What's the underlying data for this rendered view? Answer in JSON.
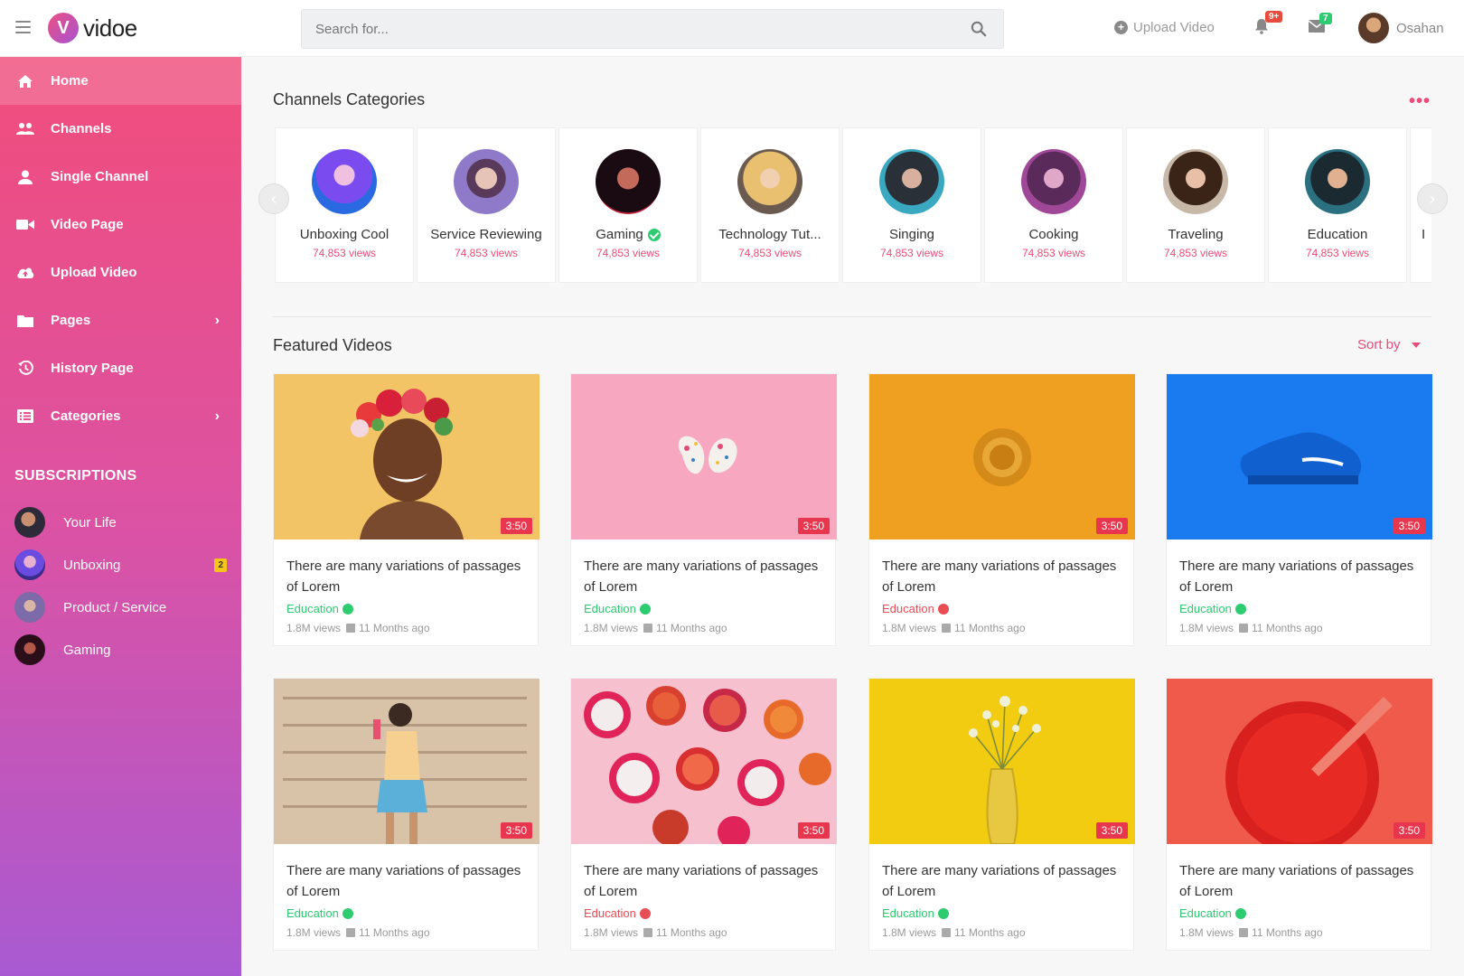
{
  "app": {
    "logo_letter": "V",
    "logo_text": "vidoe"
  },
  "header": {
    "search_placeholder": "Search for...",
    "upload_label": "Upload Video",
    "notif_count": "9+",
    "mail_count": "7",
    "user_name": "Osahan"
  },
  "sidebar": {
    "items": [
      {
        "label": "Home",
        "icon": "home-icon"
      },
      {
        "label": "Channels",
        "icon": "users-icon"
      },
      {
        "label": "Single Channel",
        "icon": "user-icon"
      },
      {
        "label": "Video Page",
        "icon": "video-camera-icon"
      },
      {
        "label": "Upload Video",
        "icon": "cloud-upload-icon"
      },
      {
        "label": "Pages",
        "icon": "folder-icon",
        "chevron": "›"
      },
      {
        "label": "History Page",
        "icon": "history-icon"
      },
      {
        "label": "Categories",
        "icon": "list-icon",
        "chevron": "›"
      }
    ],
    "subscriptions_title": "SUBSCRIPTIONS",
    "subscriptions": [
      {
        "label": "Your Life"
      },
      {
        "label": "Unboxing",
        "badge": "2"
      },
      {
        "label": "Product / Service"
      },
      {
        "label": "Gaming"
      }
    ]
  },
  "channels": {
    "title": "Channels Categories",
    "more": "•••",
    "items": [
      {
        "name": "Unboxing Cool",
        "views": "74,853 views"
      },
      {
        "name": "Service Reviewing",
        "views": "74,853 views"
      },
      {
        "name": "Gaming",
        "views": "74,853 views",
        "verified": true
      },
      {
        "name": "Technology Tut...",
        "views": "74,853 views"
      },
      {
        "name": "Singing",
        "views": "74,853 views"
      },
      {
        "name": "Cooking",
        "views": "74,853 views"
      },
      {
        "name": "Traveling",
        "views": "74,853 views"
      },
      {
        "name": "Education",
        "views": "74,853 views"
      },
      {
        "name": "I",
        "views": ""
      }
    ],
    "prev": "‹",
    "next": "›"
  },
  "featured": {
    "title": "Featured Videos",
    "sort_label": "Sort by",
    "videos": [
      {
        "title": "There are many variations of passages of Lorem",
        "category": "Education",
        "status": "green",
        "views": "1.8M views",
        "age": "11 Months ago",
        "duration": "3:50"
      },
      {
        "title": "There are many variations of passages of Lorem",
        "category": "Education",
        "status": "green",
        "views": "1.8M views",
        "age": "11 Months ago",
        "duration": "3:50"
      },
      {
        "title": "There are many variations of passages of Lorem",
        "category": "Education",
        "status": "red",
        "views": "1.8M views",
        "age": "11 Months ago",
        "duration": "3:50"
      },
      {
        "title": "There are many variations of passages of Lorem",
        "category": "Education",
        "status": "green",
        "views": "1.8M views",
        "age": "11 Months ago",
        "duration": "3:50"
      },
      {
        "title": "There are many variations of passages of Lorem",
        "category": "Education",
        "status": "green",
        "views": "1.8M views",
        "age": "11 Months ago",
        "duration": "3:50"
      },
      {
        "title": "There are many variations of passages of Lorem",
        "category": "Education",
        "status": "red",
        "views": "1.8M views",
        "age": "11 Months ago",
        "duration": "3:50"
      },
      {
        "title": "There are many variations of passages of Lorem",
        "category": "Education",
        "status": "green",
        "views": "1.8M views",
        "age": "11 Months ago",
        "duration": "3:50"
      },
      {
        "title": "There are many variations of passages of Lorem",
        "category": "Education",
        "status": "green",
        "views": "1.8M views",
        "age": "11 Months ago",
        "duration": "3:50"
      }
    ]
  },
  "colors": {
    "accent": "#e84d7a",
    "sidebar_top": "#f14d7b",
    "sidebar_bottom": "#a95ad2",
    "success": "#2ecc71",
    "danger": "#e84d55"
  }
}
